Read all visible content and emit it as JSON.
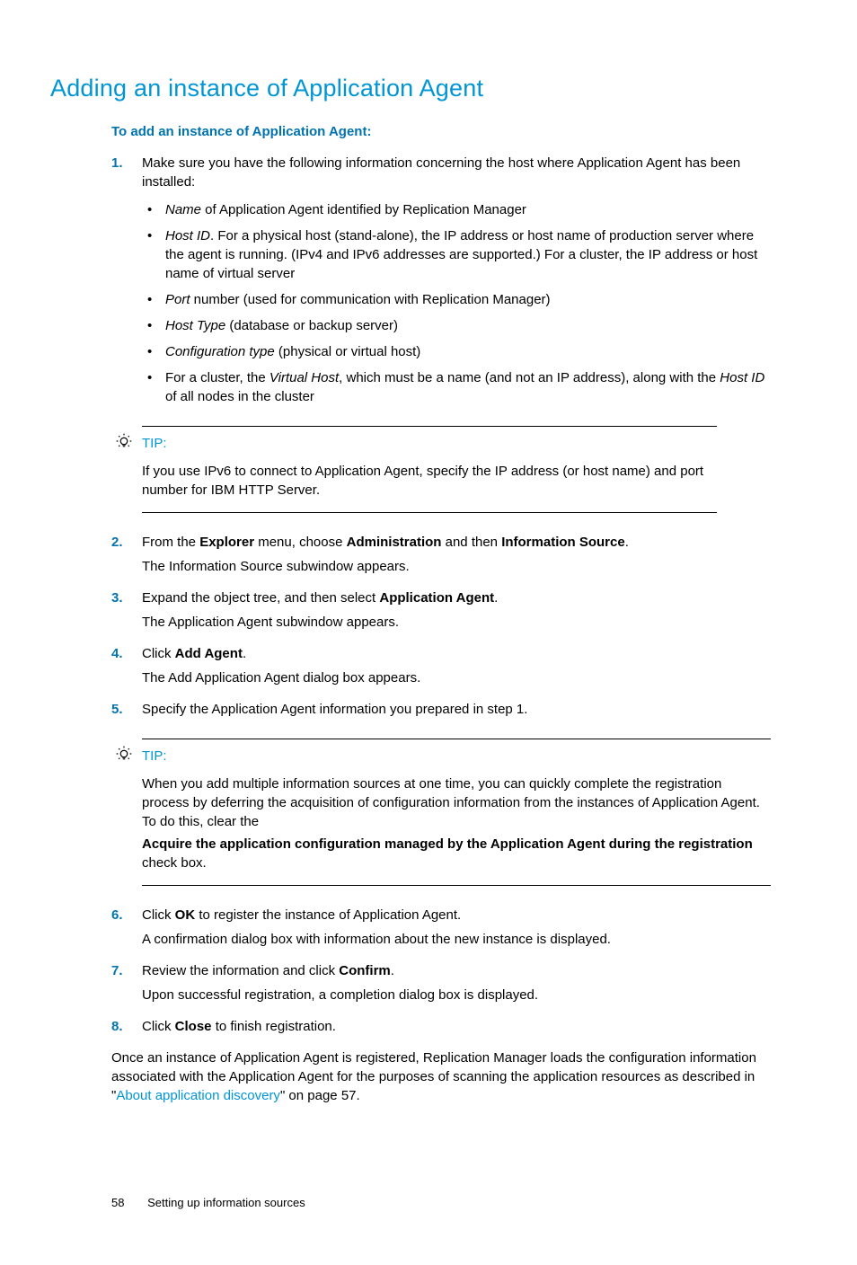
{
  "heading": "Adding an instance of Application Agent",
  "intro": "To add an instance of Application Agent:",
  "steps": {
    "s1": {
      "num": "1.",
      "text": "Make sure you have the following information concerning the host where Application Agent has been installed:",
      "b1_name": "Name",
      "b1_rest": " of Application Agent identified by Replication Manager",
      "b2_hid": "Host ID",
      "b2_rest": ". For a physical host (stand-alone), the IP address or host name of production server where the agent is running. (IPv4 and IPv6 addresses are supported.) For a cluster, the IP address or host name of virtual server",
      "b3_port": "Port",
      "b3_rest": " number (used for communication with Replication Manager)",
      "b4_ht": "Host Type",
      "b4_rest": " (database or backup server)",
      "b5_ct": "Configuration type",
      "b5_rest": " (physical or virtual host)",
      "b6_a": "For a cluster, the ",
      "b6_vh": "Virtual Host",
      "b6_b": ", which must be a name (and not an IP address), along with the ",
      "b6_hid": "Host ID",
      "b6_c": " of all nodes in the cluster"
    },
    "tip1": {
      "label": "TIP:",
      "text": "If you use IPv6 to connect to Application Agent, specify the IP address (or host name) and port number for IBM HTTP Server."
    },
    "s2": {
      "num": "2.",
      "a": "From the ",
      "explorer": "Explorer",
      "b": " menu, choose ",
      "admin": "Administration",
      "c": " and then ",
      "infosrc": "Information Source",
      "d": ".",
      "p": "The Information Source subwindow appears."
    },
    "s3": {
      "num": "3.",
      "a": "Expand the object tree, and then select ",
      "aa": "Application Agent",
      "b": ".",
      "p": "The Application Agent subwindow appears."
    },
    "s4": {
      "num": "4.",
      "a": "Click ",
      "add": "Add Agent",
      "b": ".",
      "p": "The Add Application Agent dialog box appears."
    },
    "s5": {
      "num": "5.",
      "text": "Specify the Application Agent information you prepared in step 1."
    },
    "tip2": {
      "label": "TIP:",
      "a": "When you add multiple information sources at one time, you can quickly complete the registration process by deferring the acquisition of configuration information from the instances of Application Agent. To do this, clear the",
      "bold": "Acquire the application configuration managed by the Application Agent during the registration",
      "b": "check box."
    },
    "s6": {
      "num": "6.",
      "a": "Click ",
      "ok": "OK",
      "b": " to register the instance of Application Agent.",
      "p": "A confirmation dialog box with information about the new instance is displayed."
    },
    "s7": {
      "num": "7.",
      "a": "Review the information and click ",
      "confirm": "Confirm",
      "b": ".",
      "p": "Upon successful registration, a completion dialog box is displayed."
    },
    "s8": {
      "num": "8.",
      "a": "Click ",
      "close": "Close",
      "b": " to finish registration."
    }
  },
  "closing": {
    "a": "Once an instance of Application Agent is registered, Replication Manager loads the configuration information associated with the Application Agent for the purposes of scanning the application resources as described in \"",
    "link": "About application discovery",
    "b": "\" on page 57."
  },
  "footer": {
    "page": "58",
    "section": "Setting up information sources"
  }
}
